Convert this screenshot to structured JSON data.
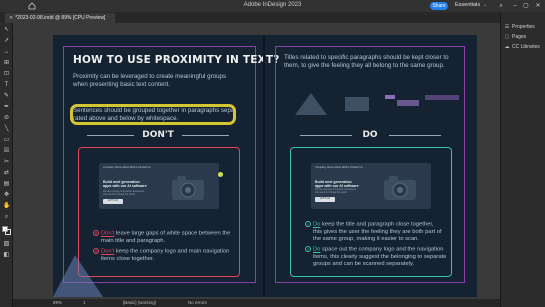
{
  "app": {
    "title": "Adobe InDesign 2023",
    "share_label": "Share",
    "workspace_label": "Essentials",
    "workspace_chevron": "⌄"
  },
  "document_tab": {
    "close_glyph": "✕",
    "label": "*2023-02-08.indd @ 89% [CPU Preview]"
  },
  "tools": [
    "↖",
    "↗",
    "↔",
    "⊞",
    "⊡",
    "T",
    "✎",
    "✒",
    "⊘",
    "╲",
    "▭",
    "☒",
    "✂",
    "⇄",
    "▤",
    "✥",
    "✋",
    "⌕",
    "▨",
    "◧"
  ],
  "right_panel": {
    "items": [
      {
        "icon": "☰",
        "label": "Properties"
      },
      {
        "icon": "▢",
        "label": "Pages"
      },
      {
        "icon": "☁",
        "label": "CC Libraries"
      }
    ]
  },
  "left_page": {
    "title": "HOW TO USE PROXIMITY IN TEXT?",
    "intro_line1": "Proximity can be leveraged to create meaningful groups",
    "intro_line2": "when presenting basic text content.",
    "highlight_line1": "Sentences should be grouped together in paragraphs sepa",
    "highlight_line2": "rated above and below by whitespace.",
    "section_heading": "DON'T",
    "mock": {
      "nav": "Company       Home    About    Works    Contact Us",
      "title_line1": "Build next generation",
      "title_line2": "apps with our AI software",
      "sub_line1": "We are a group of dynamic developers",
      "sub_line2": "who want to change the world",
      "button": "LET'S GO"
    },
    "bullet1_keyword": "Don't",
    "bullet1_rest": " leave large gaps of white space between the",
    "bullet1_line2": "main title and paragraph.",
    "bullet2_keyword": "Don't",
    "bullet2_rest": " keep the company logo and main navigation",
    "bullet2_line2": "items close together."
  },
  "right_page": {
    "intro_line1": "Titles related to specific paragraphs should be kept closer to",
    "intro_line2": "them, to give the feeling they all belong to the same group.",
    "section_heading": "DO",
    "mock": {
      "nav": "Company      Home   About   Works   Contact Us",
      "title_line1": "Build next generation",
      "title_line2": "apps with our AI software",
      "sub_line1": "We are a group of dynamic developers",
      "sub_line2": "who want to change the world",
      "button": "LET'S GO"
    },
    "bullet1_keyword": "Do",
    "bullet1_rest": " keep the title and paragraph close together,",
    "bullet1_line2": "this gives the user the feeling they are both part of",
    "bullet1_line3": "the same group, making it easier to scan.",
    "bullet2_keyword": "Do",
    "bullet2_rest": " space out the company logo and the navigation",
    "bullet2_line2": "items, this clearly suggest the belonging to separate",
    "bullet2_line3": "groups and can be scanned separately."
  },
  "status": {
    "zoom": "89%",
    "page_number": "1",
    "style": "[Basic] (working)",
    "errors": "No errors"
  },
  "colors": {
    "page_bg": "#142231",
    "dont_accent": "#e0455a",
    "do_accent": "#38c7a6",
    "highlight": "#d6c532",
    "guide": "#8a3fa8"
  }
}
